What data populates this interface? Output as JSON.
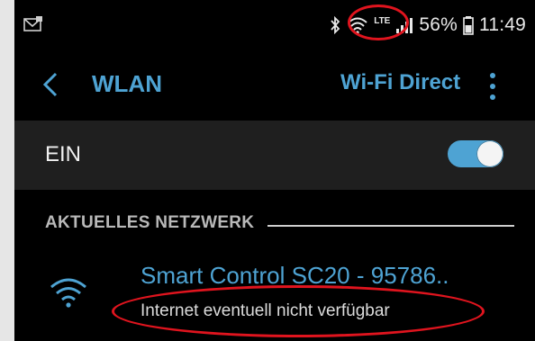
{
  "status_bar": {
    "notification_icon": "envelope-icon",
    "bluetooth_icon": "bluetooth-icon",
    "wifi_icon": "wifi-signal-icon",
    "network_type": "LTE",
    "signal_icon": "cellular-signal-icon",
    "battery_percent": "56%",
    "battery_icon": "battery-icon",
    "time": "11:49"
  },
  "action_bar": {
    "back_icon": "chevron-left-icon",
    "title": "WLAN",
    "wifi_direct_label": "Wi-Fi Direct",
    "more_icon": "more-vertical-icon"
  },
  "toggle": {
    "label": "EIN",
    "state": "on"
  },
  "current_network": {
    "section_title": "AKTUELLES NETZWERK",
    "network_icon": "wifi-icon",
    "name": "Smart Control SC20 - 95786..",
    "status": "Internet eventuell nicht verfügbar"
  },
  "colors": {
    "accent": "#4ea3d3",
    "annotation": "#e0141e",
    "background": "#000000",
    "row_highlight": "#1f1f1f"
  }
}
